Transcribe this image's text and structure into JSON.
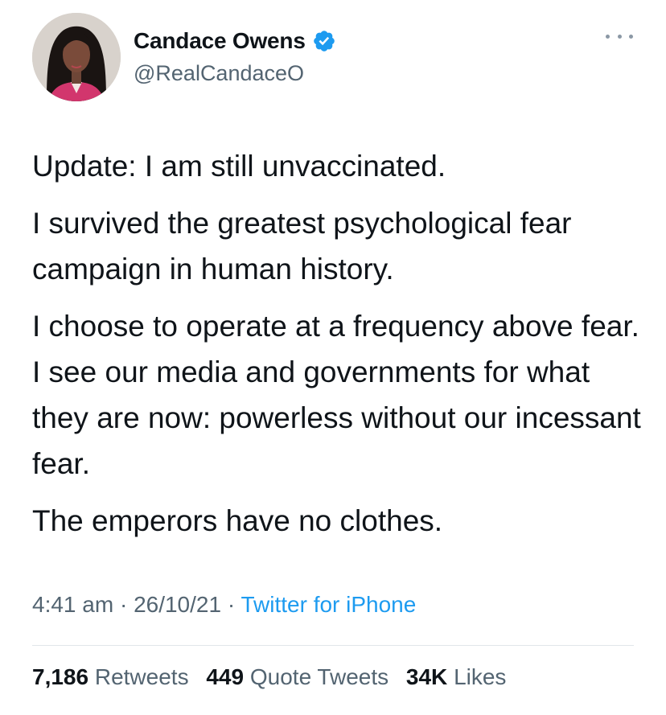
{
  "author": {
    "display_name": "Candace Owens",
    "handle": "@RealCandaceO",
    "verified_icon": "verified-badge-icon",
    "verified_color": "#1d9bf0"
  },
  "more_icon": "more-options-icon",
  "tweet": {
    "paragraphs": [
      "Update: I am still unvaccinated.",
      "I survived the greatest psychological fear campaign in human history.",
      "I choose to operate at a frequency above fear. I see our media and governments for what they are now: powerless without our incessant fear.",
      "The emperors have no clothes."
    ],
    "time": "4:41 am",
    "date": "26/10/21",
    "separator": "·",
    "source": "Twitter for iPhone"
  },
  "stats": {
    "retweets_count": "7,186",
    "retweets_label": "Retweets",
    "quotes_count": "449",
    "quotes_label": "Quote Tweets",
    "likes_count": "34K",
    "likes_label": "Likes"
  },
  "colors": {
    "text": "#0f1419",
    "secondary": "#536471",
    "link": "#1d9bf0",
    "divider": "#e1e6ea"
  }
}
